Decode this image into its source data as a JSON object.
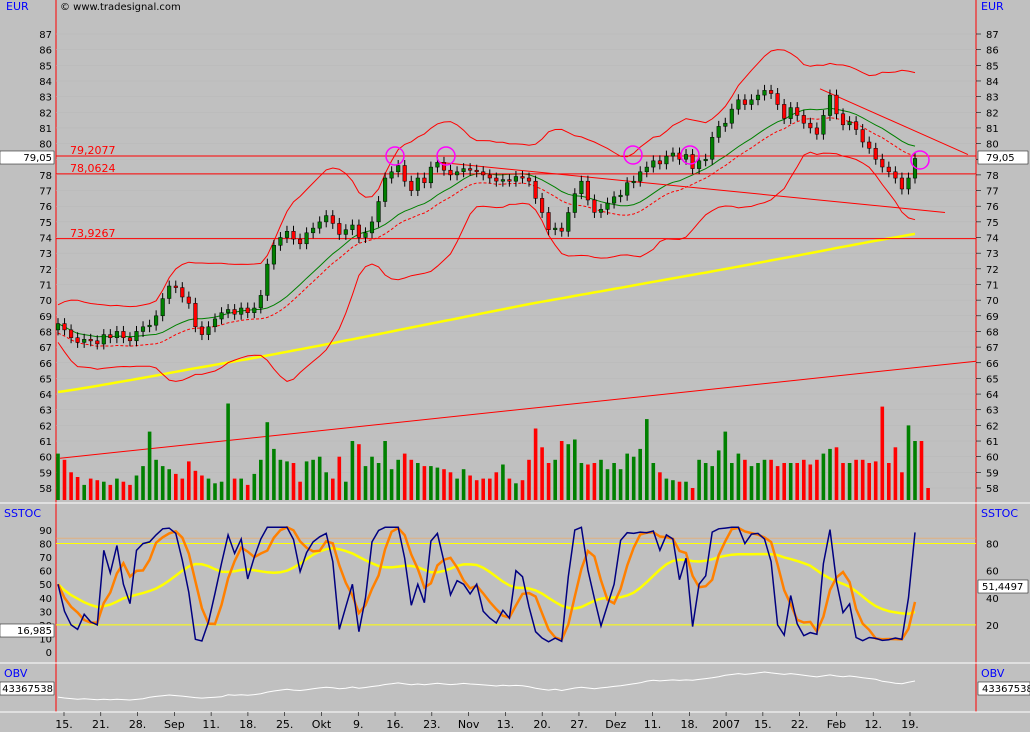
{
  "header": {
    "currency_left": "EUR",
    "currency_right": "EUR",
    "copyright": "© www.tradesignal.com"
  },
  "colors": {
    "background": "#c0c0c0",
    "up_candle": "#008000",
    "down_candle": "#ff0000",
    "level_line": "#ff0000",
    "moving_average": "#ffff00",
    "bollinger_mid": "#008000",
    "stoch_fast": "#000080",
    "stoch_slow": "#ff8000",
    "stoch_signal": "#ffff00",
    "obv": "#ffffff",
    "marker": "#ff00ff"
  },
  "chart_data": [
    {
      "type": "candlestick",
      "panel": "price",
      "y_ticks": [
        58,
        59,
        60,
        61,
        62,
        63,
        64,
        65,
        66,
        67,
        68,
        69,
        70,
        71,
        72,
        73,
        74,
        75,
        76,
        77,
        78,
        79,
        80,
        81,
        82,
        83,
        84,
        85,
        86,
        87
      ],
      "ylim": [
        57.5,
        88.5
      ],
      "levels": [
        {
          "label": "79,2077",
          "value": 79.2077
        },
        {
          "label": "78,0624",
          "value": 78.0624
        },
        {
          "label": "73,9267",
          "value": 73.9267
        }
      ],
      "last_price_label": "79,05",
      "last_price": 79.05,
      "x_tick_labels": [
        "15.",
        "21.",
        "28.",
        "Sep",
        "11.",
        "18.",
        "25.",
        "Okt",
        "9.",
        "16.",
        "23.",
        "Nov",
        "13.",
        "20.",
        "27.",
        "Dez",
        "11.",
        "18.",
        "2007",
        "15.",
        "22.",
        "Feb",
        "12.",
        "19."
      ],
      "closes": [
        68.5,
        68.1,
        67.6,
        67.3,
        67.5,
        67.4,
        67.2,
        67.8,
        67.6,
        68.0,
        67.6,
        67.4,
        68.0,
        68.3,
        68.4,
        69.0,
        70.1,
        70.9,
        70.8,
        70.2,
        69.8,
        68.3,
        67.8,
        68.3,
        68.8,
        69.2,
        69.4,
        69.1,
        69.5,
        69.2,
        69.5,
        70.3,
        72.3,
        73.5,
        74.0,
        74.4,
        73.9,
        73.6,
        74.3,
        74.6,
        75.0,
        75.4,
        74.9,
        74.2,
        74.5,
        74.8,
        74.0,
        74.3,
        75.0,
        76.3,
        77.8,
        78.2,
        78.6,
        77.6,
        77.0,
        77.8,
        77.5,
        78.5,
        78.8,
        78.3,
        78.0,
        78.2,
        78.4,
        78.3,
        78.2,
        78.0,
        77.8,
        77.6,
        77.7,
        77.6,
        77.9,
        77.8,
        77.6,
        76.5,
        75.6,
        74.5,
        74.6,
        74.4,
        75.6,
        76.8,
        77.6,
        76.4,
        75.6,
        75.8,
        76.2,
        76.6,
        76.7,
        77.5,
        77.6,
        78.2,
        78.5,
        78.9,
        78.7,
        79.2,
        79.4,
        79.0,
        79.3,
        78.4,
        78.9,
        79.0,
        80.4,
        81.1,
        81.3,
        82.2,
        82.8,
        82.5,
        82.8,
        83.1,
        83.4,
        83.2,
        82.5,
        81.6,
        82.3,
        81.8,
        81.3,
        81.0,
        80.6,
        81.8,
        83.1,
        81.9,
        81.2,
        81.4,
        80.9,
        80.1,
        79.7,
        79.0,
        78.5,
        78.2,
        77.8,
        77.1,
        77.8,
        79.05
      ],
      "volume": [
        60.2,
        59.8,
        59.0,
        58.7,
        58.2,
        58.6,
        58.5,
        58.4,
        58.2,
        58.6,
        58.4,
        58.2,
        58.8,
        59.4,
        61.6,
        59.8,
        59.4,
        59.2,
        58.9,
        58.6,
        59.7,
        59.1,
        58.8,
        58.6,
        58.3,
        58.4,
        63.4,
        58.6,
        58.6,
        58.2,
        58.9,
        59.8,
        62.2,
        60.5,
        59.8,
        59.7,
        59.6,
        58.4,
        59.7,
        59.8,
        60.0,
        59.0,
        58.6,
        60.0,
        58.4,
        61.0,
        60.8,
        59.4,
        60.0,
        59.6,
        61.0,
        59.2,
        59.8,
        60.2,
        59.8,
        59.6,
        59.4,
        59.4,
        59.3,
        59.2,
        59.0,
        58.6,
        59.2,
        58.8,
        58.5,
        58.6,
        58.6,
        59.0,
        59.5,
        58.6,
        58.3,
        58.5,
        59.8,
        61.8,
        60.6,
        59.6,
        59.8,
        61.0,
        60.8,
        61.1,
        59.6,
        59.5,
        59.6,
        59.8,
        59.2,
        59.6,
        59.2,
        60.2,
        60.0,
        60.5,
        62.4,
        59.6,
        59.0,
        58.6,
        58.5,
        58.4,
        58.4,
        58.0,
        59.8,
        59.6,
        59.4,
        60.4,
        61.6,
        59.6,
        60.2,
        59.8,
        59.4,
        59.6,
        59.8,
        59.8,
        59.4,
        59.6,
        59.6,
        59.6,
        59.8,
        59.5,
        59.8,
        60.2,
        60.5,
        60.6,
        59.6,
        59.6,
        59.8,
        59.8,
        59.6,
        59.7,
        63.2,
        59.6,
        60.6,
        59.0,
        62.0,
        61.0,
        61.0,
        58.0
      ]
    },
    {
      "type": "line",
      "panel": "stochastic",
      "label": "SSTOC",
      "y_ticks": [
        0,
        10,
        20,
        30,
        40,
        50,
        60,
        70,
        80,
        90
      ],
      "ylim": [
        -5,
        98
      ],
      "reference_levels": [
        20,
        80
      ],
      "value_labels": [
        "16,985",
        "51,4497"
      ],
      "value_label_values": [
        16.985,
        51.4497
      ]
    },
    {
      "type": "line",
      "panel": "obv",
      "label": "OBV",
      "value_label": "43367538",
      "value_label_right": "43367538"
    }
  ]
}
